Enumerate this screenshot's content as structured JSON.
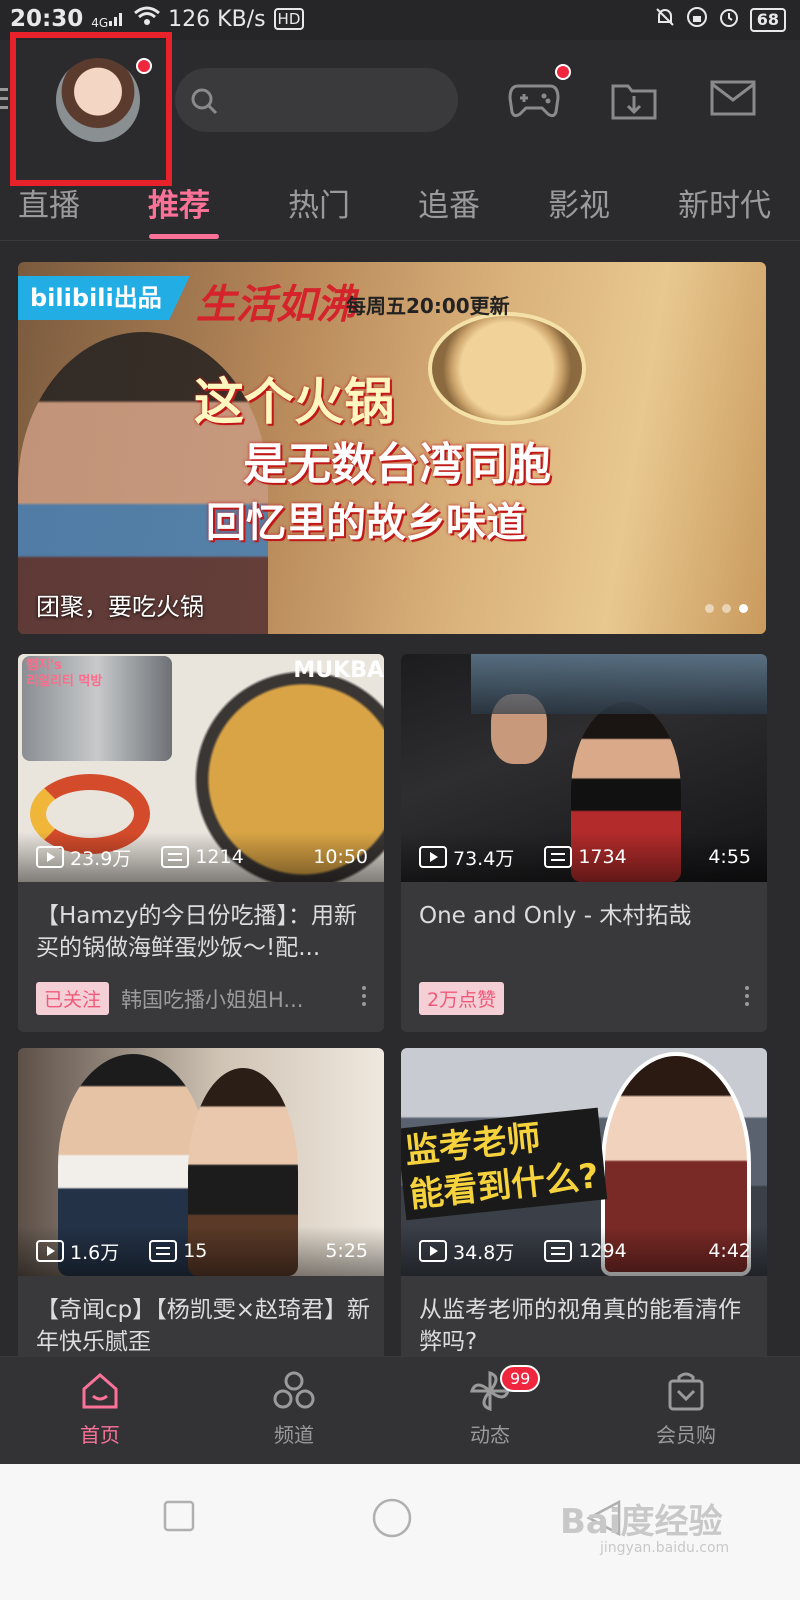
{
  "status_bar": {
    "time": "20:30",
    "network_label": "4G",
    "speed": "126 KB/s",
    "hd_label": "HD",
    "battery": "68"
  },
  "header": {
    "search": {
      "placeholder": ""
    }
  },
  "tabs": [
    "直播",
    "推荐",
    "热门",
    "追番",
    "影视",
    "新时代"
  ],
  "active_tab": "推荐",
  "banner": {
    "logo_text": "bilibili出品",
    "show_title": "生活如沸",
    "schedule": "每周五20:00更新",
    "headline_line1": "这个火锅",
    "headline_line2": "是无数台湾同胞",
    "headline_line3": "回忆里的故乡味道",
    "caption": "团聚，要吃火锅",
    "slide_count": 3,
    "active_slide": 3
  },
  "cards": [
    {
      "views": "23.9万",
      "danmaku": "1214",
      "duration": "10:50",
      "title": "【Hamzy的今日份吃播】：用新买的锅做海鲜蛋炒饭～!配...",
      "tag": "已关注",
      "author": "韩国吃播小姐姐H...",
      "thumb_text": "MUKBA",
      "thumb_text2": "햄지's\n리얼리티 먹방"
    },
    {
      "views": "73.4万",
      "danmaku": "1734",
      "duration": "4:55",
      "title": "One and Only - 木村拓哉",
      "tag": "2万点赞",
      "author": ""
    },
    {
      "views": "1.6万",
      "danmaku": "15",
      "duration": "5:25",
      "title": "【奇闻cp】【杨凯雯×赵琦君】新年快乐腻歪",
      "tag": "",
      "author": ""
    },
    {
      "views": "34.8万",
      "danmaku": "1294",
      "duration": "4:42",
      "title": "从监考老师的视角真的能看清作弊吗?",
      "tag": "",
      "author": "",
      "thumb_text": "监考老师\n能看到什么?"
    }
  ],
  "bottom_nav": [
    {
      "label": "首页",
      "active": true,
      "icon": "home-icon"
    },
    {
      "label": "频道",
      "active": false,
      "icon": "channel-icon"
    },
    {
      "label": "动态",
      "active": false,
      "icon": "pinwheel-icon",
      "badge": "99"
    },
    {
      "label": "会员购",
      "active": false,
      "icon": "shopping-bag-icon"
    }
  ],
  "watermark": {
    "text": "Bai度经验",
    "sub": "jingyan.baidu.com"
  },
  "colors": {
    "accent": "#fb7299",
    "background": "#2b2b2d",
    "card": "#39393b",
    "badge": "#f0263e",
    "highlight_box": "#e8222a"
  }
}
